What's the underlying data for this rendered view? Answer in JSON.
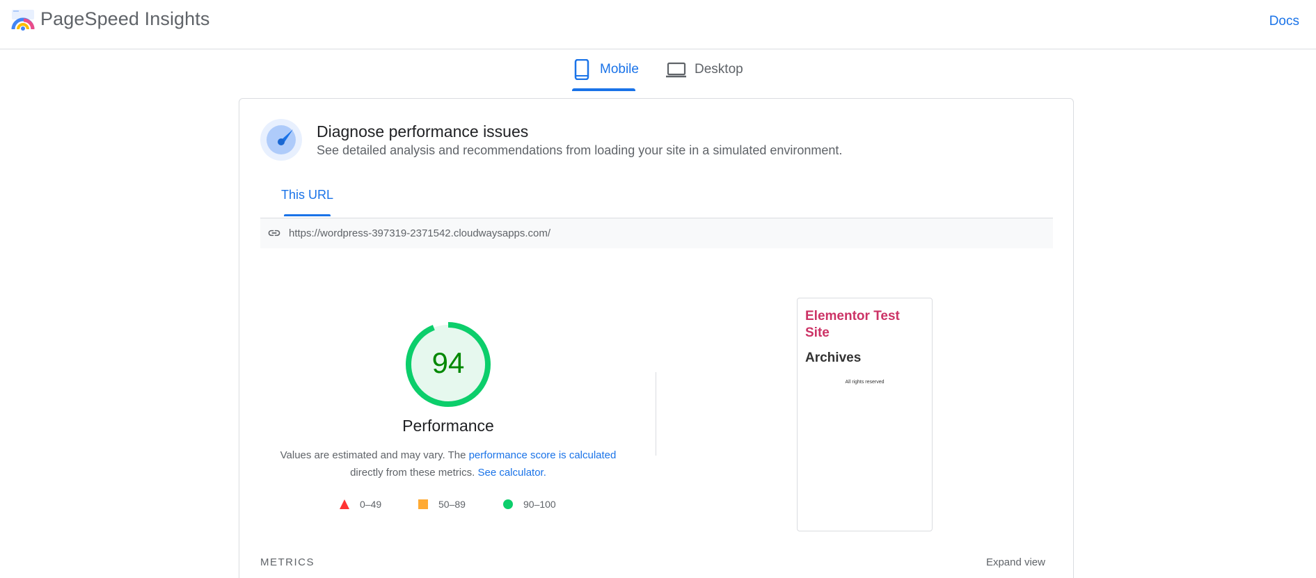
{
  "header": {
    "app_title": "PageSpeed Insights",
    "docs_label": "Docs",
    "logo_icon": "pagespeed-logo-icon"
  },
  "device_tabs": [
    {
      "label": "Mobile",
      "icon": "phone-icon",
      "selected": true
    },
    {
      "label": "Desktop",
      "icon": "laptop-icon",
      "selected": false
    }
  ],
  "diagnose": {
    "title": "Diagnose performance issues",
    "subtitle": "See detailed analysis and recommendations from loading your site in a simulated environment.",
    "icon": "speed-gauge-icon"
  },
  "url_tab": {
    "label": "This URL",
    "url": "https://wordpress-397319-2371542.cloudwaysapps.com/"
  },
  "performance": {
    "score": "94",
    "score_fraction": 0.94,
    "label": "Performance",
    "desc_prefix": "Values are estimated and may vary. The ",
    "desc_link1": "performance score is calculated",
    "desc_middle": "directly from these metrics. ",
    "desc_link2": "See calculator."
  },
  "legend": [
    {
      "range": "0–49",
      "shape": "triangle",
      "color": "#ff3333"
    },
    {
      "range": "50–89",
      "shape": "square",
      "color": "#ffaa33"
    },
    {
      "range": "90–100",
      "shape": "circle",
      "color": "#0cce6b"
    }
  ],
  "thumbnail": {
    "site_title": "Elementor Test Site",
    "heading": "Archives",
    "footer": "All rights reserved"
  },
  "metrics": {
    "label": "METRICS",
    "expand_label": "Expand view"
  },
  "colors": {
    "accent": "#1a73e8",
    "pass": "#0cce6b",
    "score_text": "#008800"
  }
}
